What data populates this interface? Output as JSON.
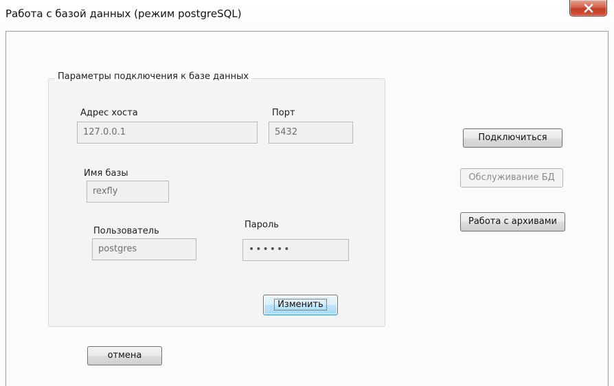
{
  "window": {
    "title": "Работа с базой данных (режим postgreSQL)",
    "close_label": "x"
  },
  "group": {
    "legend": "Параметры подключения к базе данных",
    "host_label": "Адрес хоста",
    "host_value": "127.0.0.1",
    "port_label": "Порт",
    "port_value": "5432",
    "dbname_label": "Имя базы",
    "dbname_value": "rexfly",
    "user_label": "Пользователь",
    "user_value": "postgres",
    "password_label": "Пароль",
    "password_value": "••••••",
    "change_button": "Изменить"
  },
  "actions": {
    "connect": "Подключиться",
    "maintenance": "Обслуживание БД",
    "archives": "Работа с архивами",
    "cancel": "отмена"
  }
}
